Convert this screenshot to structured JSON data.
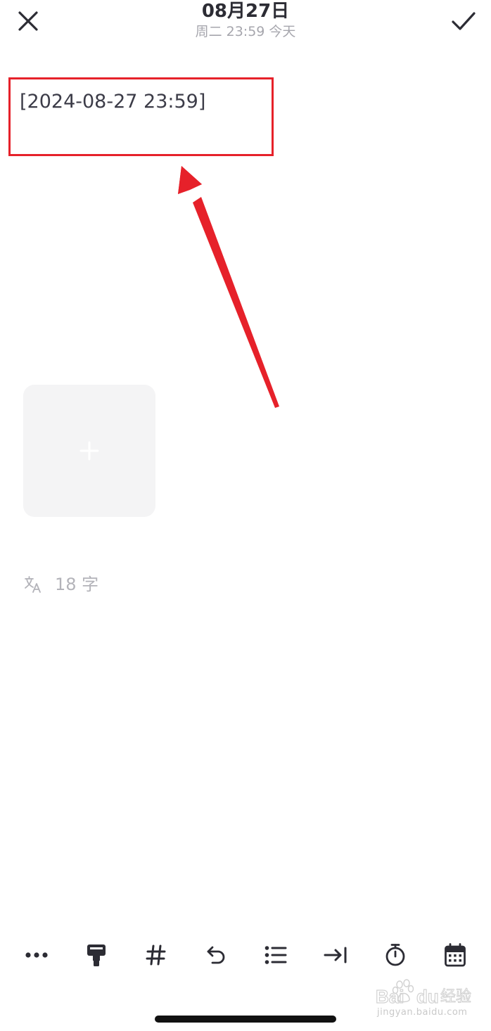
{
  "header": {
    "date_title": "08月27日",
    "date_subtitle": "周二 23:59 今天",
    "close_icon": "close-icon",
    "confirm_icon": "check-icon"
  },
  "editor": {
    "text": "[2024-08-27 23:59]"
  },
  "annotation": {
    "box_color": "#e6212a",
    "arrow_color": "#e6212a"
  },
  "attachment": {
    "add_icon": "plus-icon",
    "tile_color": "#f4f4f5"
  },
  "word_count": {
    "icon": "translate-icon",
    "text": "18 字"
  },
  "toolbar": {
    "items": [
      {
        "icon": "more-icon"
      },
      {
        "icon": "format-paint-icon"
      },
      {
        "icon": "hashtag-icon"
      },
      {
        "icon": "undo-icon"
      },
      {
        "icon": "list-icon"
      },
      {
        "icon": "indent-icon"
      },
      {
        "icon": "timer-icon"
      },
      {
        "icon": "calendar-icon"
      }
    ]
  },
  "watermark": {
    "text": "jingyan.baidu.com"
  }
}
